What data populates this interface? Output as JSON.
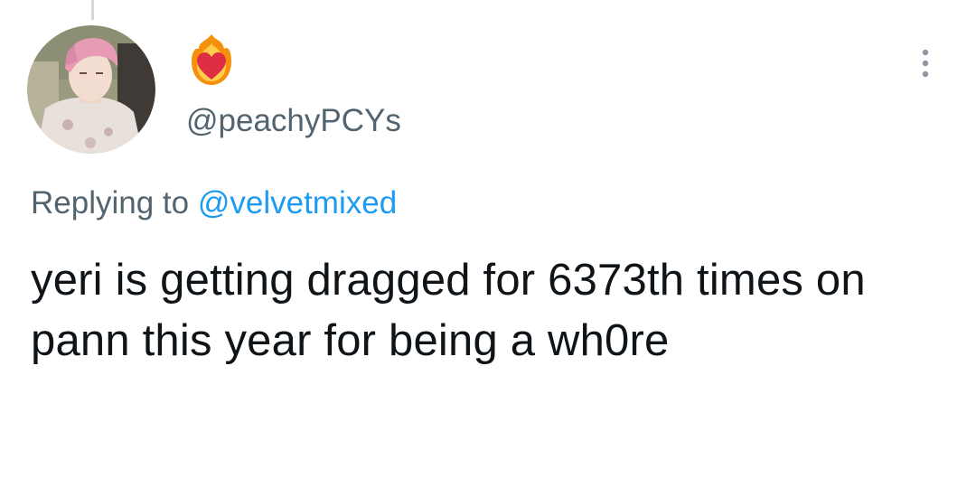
{
  "tweet": {
    "display_name_emoji": "heart-on-fire-emoji",
    "handle": "@peachyPCYs",
    "replying_to_prefix": "Replying to",
    "replying_to_handle": "@velvetmixed",
    "text": "yeri is getting dragged for 6373th times on pann this year for being a wh0re",
    "avatar_icon": "profile-photo",
    "more_icon": "more-vertical-icon"
  },
  "colors": {
    "text_primary": "#0f1419",
    "text_secondary": "#536471",
    "link": "#1d9bf0",
    "thread_line": "#cfd9de"
  }
}
